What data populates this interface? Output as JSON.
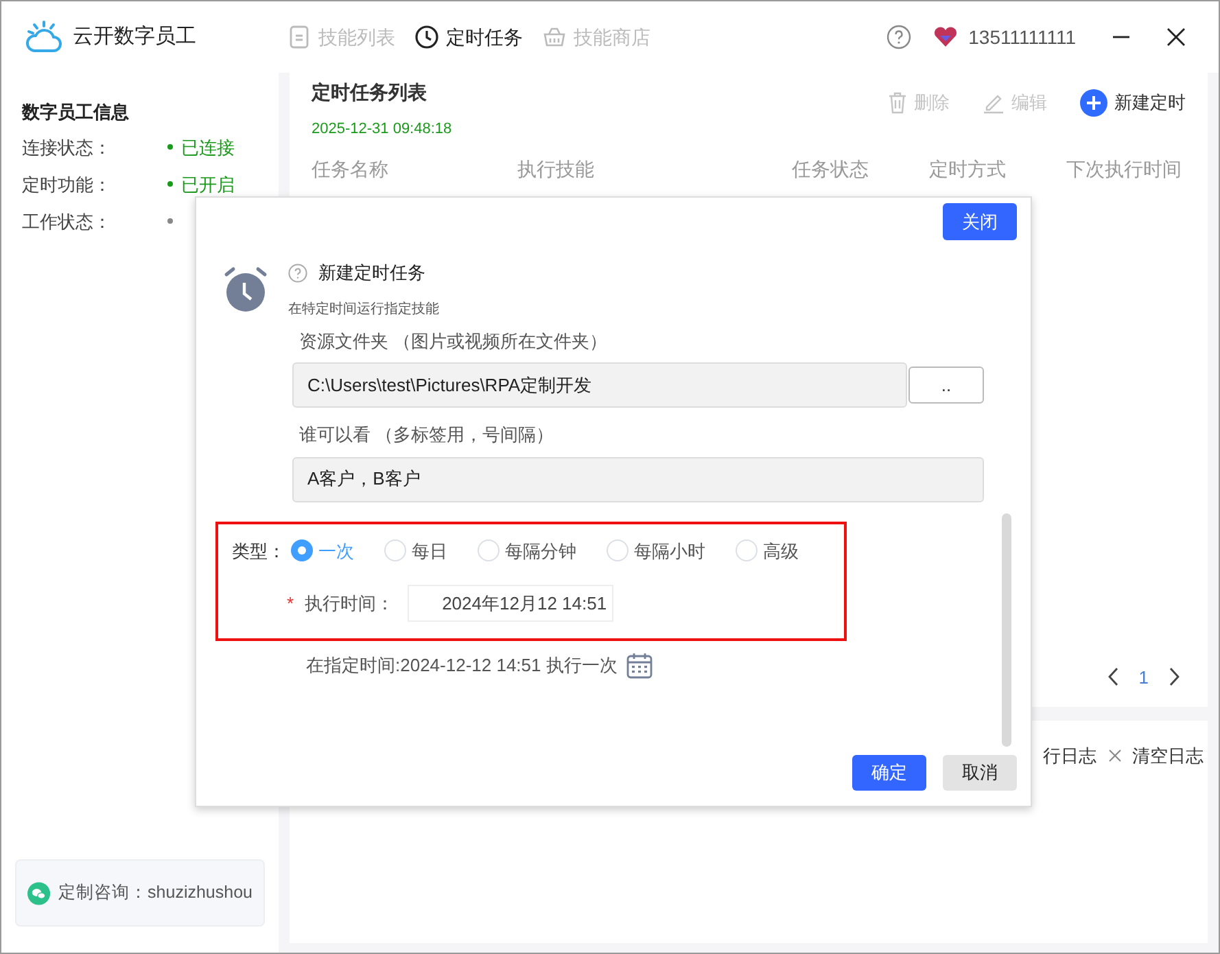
{
  "window": {
    "app_name": "云开数字员工",
    "nav_tabs": [
      {
        "label": "技能列表",
        "selected": false
      },
      {
        "label": "定时任务",
        "selected": true
      },
      {
        "label": "技能商店",
        "selected": false
      }
    ],
    "phone": "13511111111"
  },
  "sidebar": {
    "title": "数字员工信息",
    "items": [
      {
        "label": "连接状态：",
        "value": "已连接",
        "color": "#1a9a1a"
      },
      {
        "label": "定时功能：",
        "value": "已开启",
        "color": "#1a9a1a"
      },
      {
        "label": "工作状态：",
        "color": "#888888"
      }
    ],
    "contact": "定制咨询：shuzizhushou"
  },
  "task_list": {
    "title": "定时任务列表",
    "timestamp": "2025-12-31 09:48:18",
    "actions": [
      {
        "kind": "delete",
        "label": "删除",
        "disabled": true
      },
      {
        "kind": "edit",
        "label": "编辑",
        "disabled": true
      },
      {
        "kind": "add",
        "label": "新建定时",
        "disabled": false
      }
    ],
    "columns": [
      "任务名称",
      "执行技能",
      "任务状态",
      "定时方式",
      "下次执行时间"
    ],
    "page": "1"
  },
  "log_panel": {
    "view_log": "行日志",
    "clear_log": "清空日志"
  },
  "dialog": {
    "close": "关闭",
    "title": "新建定时任务",
    "subtitle": "在特定时间运行指定技能",
    "fields": [
      {
        "label": "资源文件夹",
        "hint": "（图片或视频所在文件夹）",
        "value": "C:\\Users\\test\\Pictures\\RPA定制开发",
        "browse": ".."
      },
      {
        "label": "谁可以看",
        "hint": "（多标签用，号间隔）",
        "value": "A客户，B客户"
      }
    ],
    "type_label": "类型：",
    "types": [
      {
        "label": "一次",
        "selected": true
      },
      {
        "label": "每日",
        "selected": false
      },
      {
        "label": "每隔分钟",
        "selected": false
      },
      {
        "label": "每隔小时",
        "selected": false
      },
      {
        "label": "高级",
        "selected": false
      }
    ],
    "time_label": "执行时间：",
    "required_mark": "*",
    "time_value": "2024年12月12 14:51",
    "summary": "在指定时间:2024-12-12 14:51 执行一次",
    "confirm": "确定",
    "cancel": "取消"
  }
}
